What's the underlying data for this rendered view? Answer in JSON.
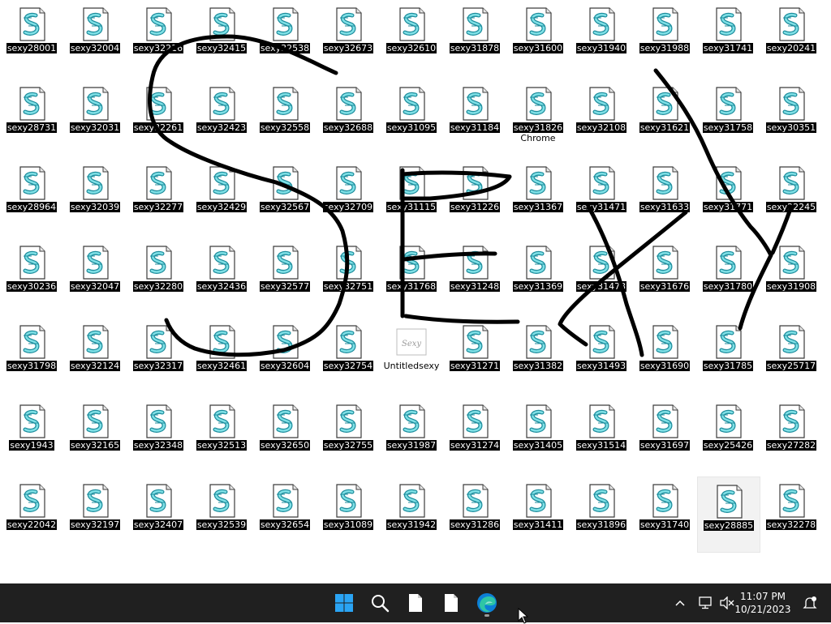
{
  "desktop": {
    "icons": [
      {
        "label": "sexy28001"
      },
      {
        "label": "sexy32004"
      },
      {
        "label": "sexy32216"
      },
      {
        "label": "sexy32415"
      },
      {
        "label": "sexy32538"
      },
      {
        "label": "sexy32673"
      },
      {
        "label": "sexy32610"
      },
      {
        "label": "sexy31878"
      },
      {
        "label": "sexy31600"
      },
      {
        "label": "sexy31940"
      },
      {
        "label": "sexy31988"
      },
      {
        "label": "sexy31741"
      },
      {
        "label": "sexy20241"
      },
      {
        "label": "sexy28731"
      },
      {
        "label": "sexy32031"
      },
      {
        "label": "sexy32261"
      },
      {
        "label": "sexy32423"
      },
      {
        "label": "sexy32558"
      },
      {
        "label": "sexy32688"
      },
      {
        "label": "sexy31095"
      },
      {
        "label": "sexy31184"
      },
      {
        "label": "sexy31826",
        "sublabel": "Chrome"
      },
      {
        "label": "sexy32108"
      },
      {
        "label": "sexy31621"
      },
      {
        "label": "sexy31758"
      },
      {
        "label": "sexy30351"
      },
      {
        "label": "sexy28964"
      },
      {
        "label": "sexy32039"
      },
      {
        "label": "sexy32277"
      },
      {
        "label": "sexy32429"
      },
      {
        "label": "sexy32567"
      },
      {
        "label": "sexy32709"
      },
      {
        "label": "sexy31115"
      },
      {
        "label": "sexy31226"
      },
      {
        "label": "sexy31367"
      },
      {
        "label": "sexy31471"
      },
      {
        "label": "sexy31633"
      },
      {
        "label": "sexy31771"
      },
      {
        "label": "sexy22245"
      },
      {
        "label": "sexy30236"
      },
      {
        "label": "sexy32047"
      },
      {
        "label": "sexy32280"
      },
      {
        "label": "sexy32436"
      },
      {
        "label": "sexy32577"
      },
      {
        "label": "sexy32751"
      },
      {
        "label": "sexy31768"
      },
      {
        "label": "sexy31248"
      },
      {
        "label": "sexy31369"
      },
      {
        "label": "sexy31473"
      },
      {
        "label": "sexy31676"
      },
      {
        "label": "sexy31780"
      },
      {
        "label": "sexy31908"
      },
      {
        "label": "sexy31798"
      },
      {
        "label": "sexy32124"
      },
      {
        "label": "sexy32317"
      },
      {
        "label": "sexy32461"
      },
      {
        "label": "sexy32604"
      },
      {
        "label": "sexy32754"
      },
      {
        "label": "Untitledsexy",
        "thumb": "Sexy"
      },
      {
        "label": "sexy31271"
      },
      {
        "label": "sexy31382"
      },
      {
        "label": "sexy31493"
      },
      {
        "label": "sexy31690"
      },
      {
        "label": "sexy31785"
      },
      {
        "label": "sexy25717"
      },
      {
        "label": "sexy1943"
      },
      {
        "label": "sexy32165"
      },
      {
        "label": "sexy32348"
      },
      {
        "label": "sexy32513"
      },
      {
        "label": "sexy32650"
      },
      {
        "label": "sexy32755"
      },
      {
        "label": "sexy31987"
      },
      {
        "label": "sexy31274"
      },
      {
        "label": "sexy31405"
      },
      {
        "label": "sexy31514"
      },
      {
        "label": "sexy31697"
      },
      {
        "label": "sexy25426"
      },
      {
        "label": "sexy27282"
      },
      {
        "label": "sexy22042"
      },
      {
        "label": "sexy32197"
      },
      {
        "label": "sexy32407"
      },
      {
        "label": "sexy32539"
      },
      {
        "label": "sexy32654"
      },
      {
        "label": "sexy31089"
      },
      {
        "label": "sexy31942"
      },
      {
        "label": "sexy31286"
      },
      {
        "label": "sexy31411"
      },
      {
        "label": "sexy31896"
      },
      {
        "label": "sexy31740"
      },
      {
        "label": "sexy28885",
        "selected": true
      },
      {
        "label": "sexy32278"
      }
    ]
  },
  "taskbar": {
    "pinned": [
      {
        "name": "start-button",
        "icon": "windows-logo-icon"
      },
      {
        "name": "search-button",
        "icon": "search-icon"
      },
      {
        "name": "file-button-1",
        "icon": "document-icon"
      },
      {
        "name": "file-button-2",
        "icon": "document-icon"
      },
      {
        "name": "edge-button",
        "icon": "edge-icon",
        "running": true
      }
    ],
    "clock": {
      "time": "11:07 PM",
      "date": "10/21/2023"
    },
    "tray": [
      "chevron-up-icon",
      "network-icon",
      "volume-muted-icon",
      "notification-icon"
    ]
  },
  "colors": {
    "taskbar": "#202020",
    "label_bg": "#000000",
    "label_text": "#ffffff",
    "win_blue": "#0078d4"
  }
}
